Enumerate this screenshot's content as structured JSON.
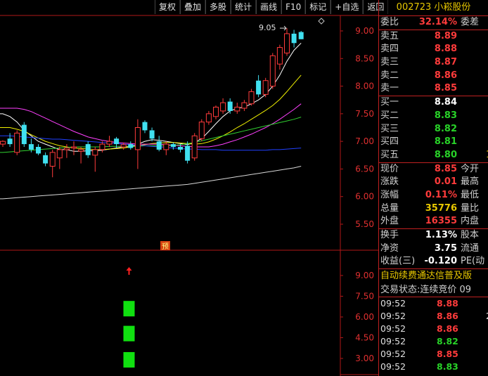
{
  "toolbar": [
    "复权",
    "叠加",
    "多股",
    "统计",
    "画线",
    "F10",
    "标记",
    "+自选",
    "返回"
  ],
  "stock": {
    "code": "002723",
    "name": "小崧股份"
  },
  "price_axis": [
    "9.00",
    "8.50",
    "8.00",
    "7.50",
    "7.00",
    "6.50",
    "6.00",
    "5.50"
  ],
  "indicator_axis": [
    "9.00",
    "7.50",
    "6.00",
    "4.50",
    "3.00"
  ],
  "high_label": "9.05",
  "pre_marker": "预",
  "colors": {
    "up": "#ff3b3b",
    "down": "#40e0f0",
    "grid": "#b01818",
    "ma5": "#ffffff",
    "ma10": "#f0f000",
    "ma20": "#ff40ff",
    "ma30": "#30d030",
    "ma60": "#2040ff",
    "ma120": "#d8d8d8"
  },
  "candles": [
    {
      "o": 6.95,
      "h": 7.02,
      "l": 6.9,
      "c": 7.0
    },
    {
      "o": 7.05,
      "h": 7.15,
      "l": 6.9,
      "c": 6.95
    },
    {
      "o": 6.8,
      "h": 7.2,
      "l": 6.75,
      "c": 7.15
    },
    {
      "o": 7.3,
      "h": 7.35,
      "l": 6.9,
      "c": 6.95
    },
    {
      "o": 6.95,
      "h": 7.05,
      "l": 6.8,
      "c": 6.85
    },
    {
      "o": 6.9,
      "h": 6.95,
      "l": 6.75,
      "c": 6.78
    },
    {
      "o": 6.75,
      "h": 6.8,
      "l": 6.55,
      "c": 6.6
    },
    {
      "o": 6.55,
      "h": 6.85,
      "l": 6.35,
      "c": 6.8
    },
    {
      "o": 6.7,
      "h": 6.9,
      "l": 6.5,
      "c": 6.85
    },
    {
      "o": 6.85,
      "h": 6.95,
      "l": 6.7,
      "c": 6.88
    },
    {
      "o": 6.88,
      "h": 7.0,
      "l": 6.75,
      "c": 6.9
    },
    {
      "o": 6.82,
      "h": 6.9,
      "l": 6.6,
      "c": 6.85
    },
    {
      "o": 6.95,
      "h": 7.0,
      "l": 6.7,
      "c": 6.75
    },
    {
      "o": 6.75,
      "h": 6.9,
      "l": 6.45,
      "c": 6.85
    },
    {
      "o": 6.85,
      "h": 7.0,
      "l": 6.8,
      "c": 6.95
    },
    {
      "o": 6.95,
      "h": 7.1,
      "l": 6.9,
      "c": 7.0
    },
    {
      "o": 7.05,
      "h": 7.08,
      "l": 6.88,
      "c": 6.95
    },
    {
      "o": 6.9,
      "h": 6.98,
      "l": 6.85,
      "c": 6.94
    },
    {
      "o": 6.95,
      "h": 7.0,
      "l": 6.85,
      "c": 6.88
    },
    {
      "o": 6.85,
      "h": 7.4,
      "l": 6.5,
      "c": 7.25
    },
    {
      "o": 7.35,
      "h": 7.38,
      "l": 7.15,
      "c": 7.2
    },
    {
      "o": 7.2,
      "h": 7.25,
      "l": 7.0,
      "c": 7.05
    },
    {
      "o": 7.0,
      "h": 7.1,
      "l": 6.82,
      "c": 6.85
    },
    {
      "o": 6.85,
      "h": 7.0,
      "l": 6.75,
      "c": 6.95
    },
    {
      "o": 6.95,
      "h": 6.98,
      "l": 6.85,
      "c": 6.9
    },
    {
      "o": 6.9,
      "h": 6.95,
      "l": 6.8,
      "c": 6.85
    },
    {
      "o": 6.92,
      "h": 7.0,
      "l": 6.6,
      "c": 6.65
    },
    {
      "o": 6.7,
      "h": 7.15,
      "l": 6.65,
      "c": 7.1
    },
    {
      "o": 7.05,
      "h": 7.4,
      "l": 7.0,
      "c": 7.35
    },
    {
      "o": 7.35,
      "h": 7.55,
      "l": 7.3,
      "c": 7.5
    },
    {
      "o": 7.45,
      "h": 7.65,
      "l": 7.4,
      "c": 7.62
    },
    {
      "o": 7.55,
      "h": 7.78,
      "l": 7.5,
      "c": 7.7
    },
    {
      "o": 7.72,
      "h": 7.78,
      "l": 7.5,
      "c": 7.55
    },
    {
      "o": 7.55,
      "h": 7.7,
      "l": 7.5,
      "c": 7.62
    },
    {
      "o": 7.6,
      "h": 7.75,
      "l": 7.55,
      "c": 7.7
    },
    {
      "o": 7.68,
      "h": 7.95,
      "l": 7.65,
      "c": 7.9
    },
    {
      "o": 8.1,
      "h": 8.2,
      "l": 7.8,
      "c": 7.85
    },
    {
      "o": 7.85,
      "h": 8.15,
      "l": 7.8,
      "c": 8.1
    },
    {
      "o": 8.0,
      "h": 8.6,
      "l": 7.95,
      "c": 8.55
    },
    {
      "o": 8.4,
      "h": 8.75,
      "l": 8.3,
      "c": 8.7
    },
    {
      "o": 8.6,
      "h": 9.05,
      "l": 8.55,
      "c": 8.95
    },
    {
      "o": 8.95,
      "h": 9.02,
      "l": 8.7,
      "c": 8.78
    },
    {
      "o": 8.98,
      "h": 9.0,
      "l": 8.85,
      "c": 8.85
    }
  ],
  "ma_lines": [
    {
      "key": "ma5",
      "v": [
        7.5,
        7.45,
        7.35,
        7.2,
        7.1,
        7.0,
        6.95,
        6.9,
        6.85,
        6.85,
        6.82,
        6.82,
        6.83,
        6.83,
        6.84,
        6.86,
        6.88,
        6.9,
        6.9,
        6.95,
        7.0,
        7.03,
        7.02,
        7.0,
        6.98,
        6.96,
        6.94,
        6.98,
        7.05,
        7.18,
        7.32,
        7.45,
        7.55,
        7.6,
        7.62,
        7.68,
        7.75,
        7.85,
        8.0,
        8.2,
        8.45,
        8.65,
        8.78
      ]
    },
    {
      "key": "ma10",
      "v": [
        7.25,
        7.25,
        7.22,
        7.18,
        7.12,
        7.06,
        7.0,
        6.96,
        6.92,
        6.9,
        6.88,
        6.87,
        6.86,
        6.85,
        6.85,
        6.86,
        6.87,
        6.88,
        6.9,
        6.92,
        6.94,
        6.96,
        6.97,
        6.98,
        6.98,
        6.97,
        6.96,
        6.95,
        6.96,
        6.99,
        7.04,
        7.1,
        7.17,
        7.25,
        7.32,
        7.4,
        7.48,
        7.56,
        7.65,
        7.76,
        7.9,
        8.05,
        8.2
      ]
    },
    {
      "key": "ma20",
      "v": [
        7.6,
        7.6,
        7.6,
        7.58,
        7.54,
        7.48,
        7.42,
        7.36,
        7.3,
        7.24,
        7.18,
        7.13,
        7.08,
        7.05,
        7.02,
        7.0,
        6.98,
        6.97,
        6.96,
        6.95,
        6.95,
        6.95,
        6.95,
        6.94,
        6.93,
        6.92,
        6.91,
        6.9,
        6.9,
        6.9,
        6.92,
        6.95,
        6.99,
        7.03,
        7.08,
        7.13,
        7.19,
        7.25,
        7.32,
        7.4,
        7.49,
        7.58,
        7.68
      ]
    },
    {
      "key": "ma30",
      "v": [
        6.8,
        6.81,
        6.82,
        6.83,
        6.84,
        6.85,
        6.86,
        6.87,
        6.88,
        6.89,
        6.9,
        6.9,
        6.9,
        6.9,
        6.9,
        6.91,
        6.91,
        6.91,
        6.91,
        6.91,
        6.92,
        6.92,
        6.92,
        6.92,
        6.93,
        6.94,
        6.96,
        6.98,
        7.01,
        7.04,
        7.07,
        7.1,
        7.13,
        7.16,
        7.19,
        7.22,
        7.25,
        7.28,
        7.31,
        7.34,
        7.37,
        7.4,
        7.44
      ]
    },
    {
      "key": "ma60",
      "v": [
        7.1,
        7.1,
        7.09,
        7.08,
        7.07,
        7.06,
        7.05,
        7.04,
        7.04,
        7.03,
        7.02,
        7.01,
        7.0,
        6.99,
        6.98,
        6.97,
        6.96,
        6.95,
        6.94,
        6.93,
        6.92,
        6.91,
        6.9,
        6.89,
        6.88,
        6.87,
        6.86,
        6.86,
        6.85,
        6.85,
        6.85,
        6.84,
        6.84,
        6.84,
        6.84,
        6.84,
        6.84,
        6.84,
        6.85,
        6.85,
        6.86,
        6.87,
        6.88
      ]
    },
    {
      "key": "ma120",
      "v": [
        5.96,
        5.97,
        5.98,
        5.99,
        6.0,
        6.01,
        6.02,
        6.03,
        6.04,
        6.05,
        6.06,
        6.07,
        6.08,
        6.09,
        6.1,
        6.11,
        6.12,
        6.13,
        6.14,
        6.15,
        6.16,
        6.17,
        6.18,
        6.19,
        6.2,
        6.21,
        6.22,
        6.24,
        6.26,
        6.28,
        6.3,
        6.32,
        6.34,
        6.36,
        6.38,
        6.4,
        6.42,
        6.44,
        6.46,
        6.48,
        6.5,
        6.52,
        6.55
      ]
    }
  ],
  "signal_bars": [
    {
      "i": 15,
      "v": 6.6
    },
    {
      "i": 15,
      "v": 4.8
    },
    {
      "i": 15,
      "v": 2.9
    }
  ],
  "panel": {
    "weibi": {
      "label": "委比",
      "value": "32.14%",
      "label2": "委差"
    },
    "sells": [
      {
        "label": "卖五",
        "price": "8.89"
      },
      {
        "label": "卖四",
        "price": "8.88"
      },
      {
        "label": "卖三",
        "price": "8.87"
      },
      {
        "label": "卖二",
        "price": "8.86"
      },
      {
        "label": "卖一",
        "price": "8.85"
      }
    ],
    "buys": [
      {
        "label": "买一",
        "price": "8.84",
        "cls": "white"
      },
      {
        "label": "买二",
        "price": "8.83",
        "cls": "green"
      },
      {
        "label": "买三",
        "price": "8.82",
        "cls": "green"
      },
      {
        "label": "买四",
        "price": "8.81",
        "cls": "green"
      },
      {
        "label": "买五",
        "price": "8.80",
        "cls": "green",
        "extra": "1"
      }
    ],
    "quotes1": [
      {
        "label": "现价",
        "value": "8.85",
        "cls": "red",
        "label2": "今开"
      },
      {
        "label": "涨跌",
        "value": "0.01",
        "cls": "red",
        "label2": "最高"
      },
      {
        "label": "涨幅",
        "value": "0.11%",
        "cls": "red",
        "label2": "最低"
      },
      {
        "label": "总量",
        "value": "35776",
        "cls": "yellow",
        "label2": "量比"
      },
      {
        "label": "外盘",
        "value": "16355",
        "cls": "red",
        "label2": "内盘"
      }
    ],
    "quotes2": [
      {
        "label": "换手",
        "value": "1.13%",
        "cls": "white",
        "label2": "股本"
      },
      {
        "label": "净资",
        "value": "3.75",
        "cls": "white",
        "label2": "流通"
      },
      {
        "label": "收益(三)",
        "value": "-0.120",
        "cls": "white",
        "label2": "PE(动"
      }
    ],
    "ticker": "自动续费通达信普及版",
    "status": "交易状态:连续竞价 09",
    "ticks": [
      {
        "time": "09:52",
        "price": "8.88",
        "cls": "red"
      },
      {
        "time": "09:52",
        "price": "8.86",
        "cls": "red",
        "x": "2"
      },
      {
        "time": "09:52",
        "price": "8.86",
        "cls": "red"
      },
      {
        "time": "09:52",
        "price": "8.82",
        "cls": "green"
      },
      {
        "time": "09:52",
        "price": "8.85",
        "cls": "red"
      },
      {
        "time": "09:52",
        "price": "8.83",
        "cls": "green"
      }
    ]
  }
}
